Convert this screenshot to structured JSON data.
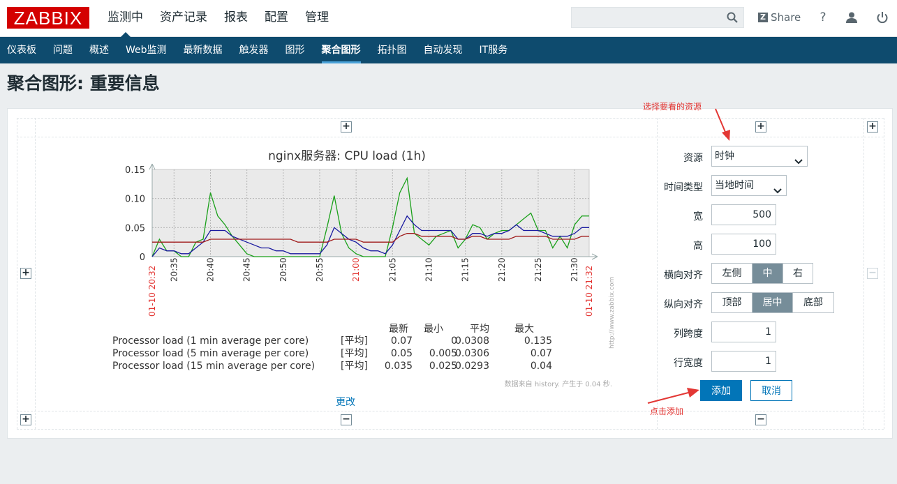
{
  "header": {
    "logo": "ZABBIX",
    "nav": [
      "监测中",
      "资产记录",
      "报表",
      "配置",
      "管理"
    ],
    "search_placeholder": "",
    "share_label": "Share",
    "help_label": "?"
  },
  "subnav": [
    "仪表板",
    "问题",
    "概述",
    "Web监测",
    "最新数据",
    "触发器",
    "图形",
    "聚合图形",
    "拓扑图",
    "自动发现",
    "IT服务"
  ],
  "page_title": "聚合图形: 重要信息",
  "chart_data": {
    "type": "line",
    "title": "nginx服务器: CPU load (1h)",
    "ylim": [
      0,
      0.15
    ],
    "yticks": [
      "0.15",
      "0.10",
      "0.05",
      "0"
    ],
    "xtick_labels": [
      "20:35",
      "20:40",
      "20:45",
      "20:50",
      "20:55",
      "21:00",
      "21:05",
      "21:10",
      "21:15",
      "21:20",
      "21:25",
      "21:30"
    ],
    "x_start_label": "01-10 20:32",
    "x_end_label": "01-10 21:32",
    "watermark": "http://www.zabbix.com",
    "x": [
      "20:32",
      "20:33",
      "20:34",
      "20:35",
      "20:36",
      "20:37",
      "20:38",
      "20:39",
      "20:40",
      "20:41",
      "20:42",
      "20:43",
      "20:44",
      "20:45",
      "20:46",
      "20:47",
      "20:48",
      "20:49",
      "20:50",
      "20:51",
      "20:52",
      "20:53",
      "20:54",
      "20:55",
      "20:56",
      "20:57",
      "20:58",
      "20:59",
      "21:00",
      "21:01",
      "21:02",
      "21:03",
      "21:04",
      "21:05",
      "21:06",
      "21:07",
      "21:08",
      "21:09",
      "21:10",
      "21:11",
      "21:12",
      "21:13",
      "21:14",
      "21:15",
      "21:16",
      "21:17",
      "21:18",
      "21:19",
      "21:20",
      "21:21",
      "21:22",
      "21:23",
      "21:24",
      "21:25",
      "21:26",
      "21:27",
      "21:28",
      "21:29",
      "21:30",
      "21:31",
      "21:32"
    ],
    "series": [
      {
        "name": "Processor load (1 min average per core)",
        "color": "#1aa01a",
        "values": [
          0,
          0.03,
          0.01,
          0.01,
          0,
          0,
          0.025,
          0.03,
          0.11,
          0.07,
          0.055,
          0.035,
          0.02,
          0.005,
          0,
          0,
          0,
          0,
          0,
          0,
          0,
          0,
          0,
          0,
          0.05,
          0.105,
          0.04,
          0.015,
          0.005,
          0,
          0,
          0,
          0,
          0.05,
          0.11,
          0.135,
          0.04,
          0.03,
          0.02,
          0.035,
          0.04,
          0.045,
          0.015,
          0.03,
          0.055,
          0.05,
          0.03,
          0.04,
          0.045,
          0.045,
          0.055,
          0.065,
          0.075,
          0.045,
          0.045,
          0.015,
          0.035,
          0.015,
          0.055,
          0.07,
          0.07
        ]
      },
      {
        "name": "Processor load (5 min average per core)",
        "color": "#1a1aa0",
        "values": [
          0,
          0.015,
          0.01,
          0.01,
          0.005,
          0.005,
          0.015,
          0.025,
          0.045,
          0.045,
          0.045,
          0.035,
          0.03,
          0.025,
          0.02,
          0.015,
          0.015,
          0.01,
          0.01,
          0.005,
          0.005,
          0.005,
          0.005,
          0.005,
          0.02,
          0.05,
          0.04,
          0.03,
          0.025,
          0.015,
          0.01,
          0.01,
          0.005,
          0.02,
          0.045,
          0.07,
          0.055,
          0.045,
          0.045,
          0.045,
          0.045,
          0.045,
          0.03,
          0.03,
          0.04,
          0.04,
          0.035,
          0.04,
          0.04,
          0.045,
          0.055,
          0.045,
          0.045,
          0.045,
          0.04,
          0.035,
          0.035,
          0.035,
          0.04,
          0.05,
          0.05
        ]
      },
      {
        "name": "Processor load (15 min average per core)",
        "color": "#a01a1a",
        "values": [
          0.025,
          0.025,
          0.025,
          0.025,
          0.025,
          0.025,
          0.025,
          0.025,
          0.03,
          0.03,
          0.03,
          0.03,
          0.03,
          0.03,
          0.03,
          0.03,
          0.03,
          0.03,
          0.03,
          0.03,
          0.025,
          0.025,
          0.025,
          0.025,
          0.025,
          0.03,
          0.03,
          0.03,
          0.03,
          0.025,
          0.025,
          0.025,
          0.025,
          0.025,
          0.035,
          0.04,
          0.04,
          0.035,
          0.035,
          0.035,
          0.035,
          0.035,
          0.03,
          0.03,
          0.035,
          0.035,
          0.03,
          0.03,
          0.03,
          0.03,
          0.035,
          0.035,
          0.035,
          0.035,
          0.035,
          0.03,
          0.03,
          0.03,
          0.03,
          0.035,
          0.035
        ]
      }
    ],
    "legend_headers": [
      "最新",
      "最小",
      "平均",
      "最大"
    ],
    "legend_rows": [
      {
        "name": "Processor load (1 min average per core)",
        "func": "[平均]",
        "last": "0.07",
        "min": "0",
        "avg": "0.0308",
        "max": "0.135",
        "color": "#1aa01a"
      },
      {
        "name": "Processor load (5 min average per core)",
        "func": "[平均]",
        "last": "0.05",
        "min": "0.005",
        "avg": "0.0306",
        "max": "0.07",
        "color": "#1a1aa0"
      },
      {
        "name": "Processor load (15 min average per core)",
        "func": "[平均]",
        "last": "0.035",
        "min": "0.025",
        "avg": "0.0293",
        "max": "0.04",
        "color": "#a01a1a"
      }
    ],
    "footer_note": "数据来自 history. 产生于 0.04 秒."
  },
  "edit_link": "更改",
  "form": {
    "resource_label": "资源",
    "resource_value": "时钟",
    "time_type_label": "时间类型",
    "time_type_value": "当地时间",
    "width_label": "宽",
    "width_value": "500",
    "height_label": "高",
    "height_value": "100",
    "halign_label": "横向对齐",
    "halign_options": [
      "左侧",
      "中",
      "右"
    ],
    "valign_label": "纵向对齐",
    "valign_options": [
      "顶部",
      "居中",
      "底部"
    ],
    "colspan_label": "列跨度",
    "colspan_value": "1",
    "rowspan_label": "行宽度",
    "rowspan_value": "1",
    "add_label": "添加",
    "cancel_label": "取消"
  },
  "annotations": {
    "select_resource": "选择要看的资源",
    "click_add": "点击添加",
    "color": "#e33734"
  }
}
